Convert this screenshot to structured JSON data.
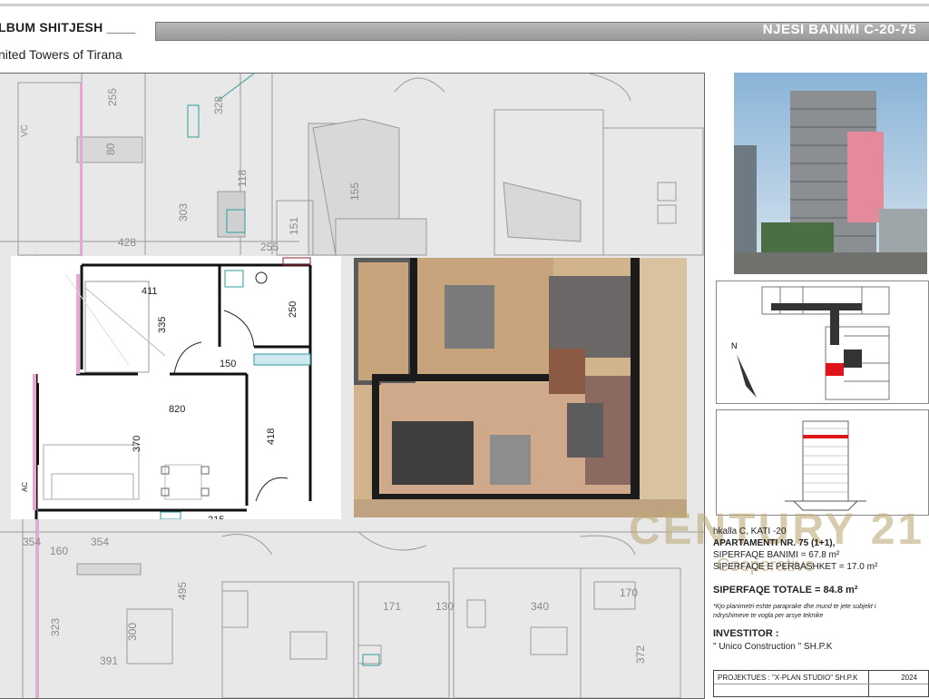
{
  "header": {
    "album_title": "LBUM SHITJESH ____",
    "project": "nited  Towers of Tirana",
    "unit_code": "NJESI BANIMI C-20-75"
  },
  "plan": {
    "dims": [
      "411",
      "335",
      "250",
      "150",
      "820",
      "370",
      "418",
      "215",
      "255",
      "428",
      "303",
      "118",
      "80",
      "255",
      "328",
      "155",
      "151",
      "160",
      "354",
      "495",
      "323",
      "300",
      "391",
      "171",
      "130",
      "340",
      "170",
      "372",
      "AC",
      "VC"
    ]
  },
  "info": {
    "stair_floor": "hkalla C, KATI -20",
    "apartment": "APARTAMENTI NR. 75 (1+1),",
    "area_living": "SIPERFAQE BANIMI = 67.8 m²",
    "area_common": "SIPERFAQE E PERBASHKET = 17.0 m²",
    "area_total": "SIPERFAQE TOTALE = 84.8 m²",
    "note": "*Kjo planimetri eshte paraprake dhe mund te jete subjekt i ndryshimeve te vogla per arsye teknike",
    "investor_label": "INVESTITOR :",
    "investor": "\" Unico Construction \" SH.P.K",
    "projektues": "PROJEKTUES : \"X-PLAN STUDIO\" SH.P.K",
    "year": "2024"
  },
  "watermark": {
    "brand": "CENTURY 21",
    "sub": "Cooperative"
  },
  "compass": {
    "label": "N"
  }
}
